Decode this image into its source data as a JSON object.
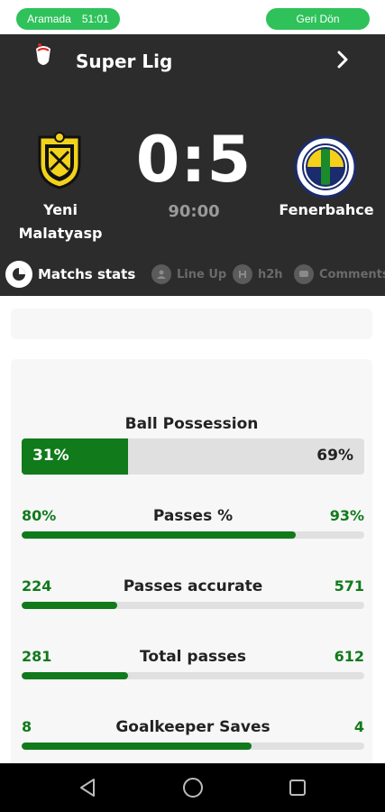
{
  "status": {
    "call_label": "Aramada",
    "call_time": "51:01",
    "back_label": "Geri Dön"
  },
  "league": {
    "title": "Super Lig"
  },
  "match": {
    "home_name": "Yeni Malatyasp",
    "away_name": "Fenerbahce",
    "score": "0:5",
    "clock": "90:00"
  },
  "tabs": [
    {
      "label": "Matchs stats",
      "icon": "pie-chart-icon"
    },
    {
      "label": "Line Up",
      "icon": "lineup-icon"
    },
    {
      "label": "h2h",
      "icon": "h2h-icon"
    },
    {
      "label": "Comments",
      "icon": "comments-icon"
    }
  ],
  "possession": {
    "title": "Ball Possession",
    "home": "31%",
    "away": "69%",
    "home_fraction": 0.31
  },
  "stats": [
    {
      "title": "Passes %",
      "home": "80%",
      "away": "93%",
      "home_fraction": 0.8
    },
    {
      "title": "Passes accurate",
      "home": "224",
      "away": "571",
      "home_fraction": 0.28
    },
    {
      "title": "Total passes",
      "home": "281",
      "away": "612",
      "home_fraction": 0.31
    },
    {
      "title": "Goalkeeper Saves",
      "home": "8",
      "away": "4",
      "home_fraction": 0.67
    }
  ],
  "colors": {
    "accent_green": "#117a1b",
    "pill_green": "#2fc25b",
    "header_bg": "#2c2c2c"
  }
}
